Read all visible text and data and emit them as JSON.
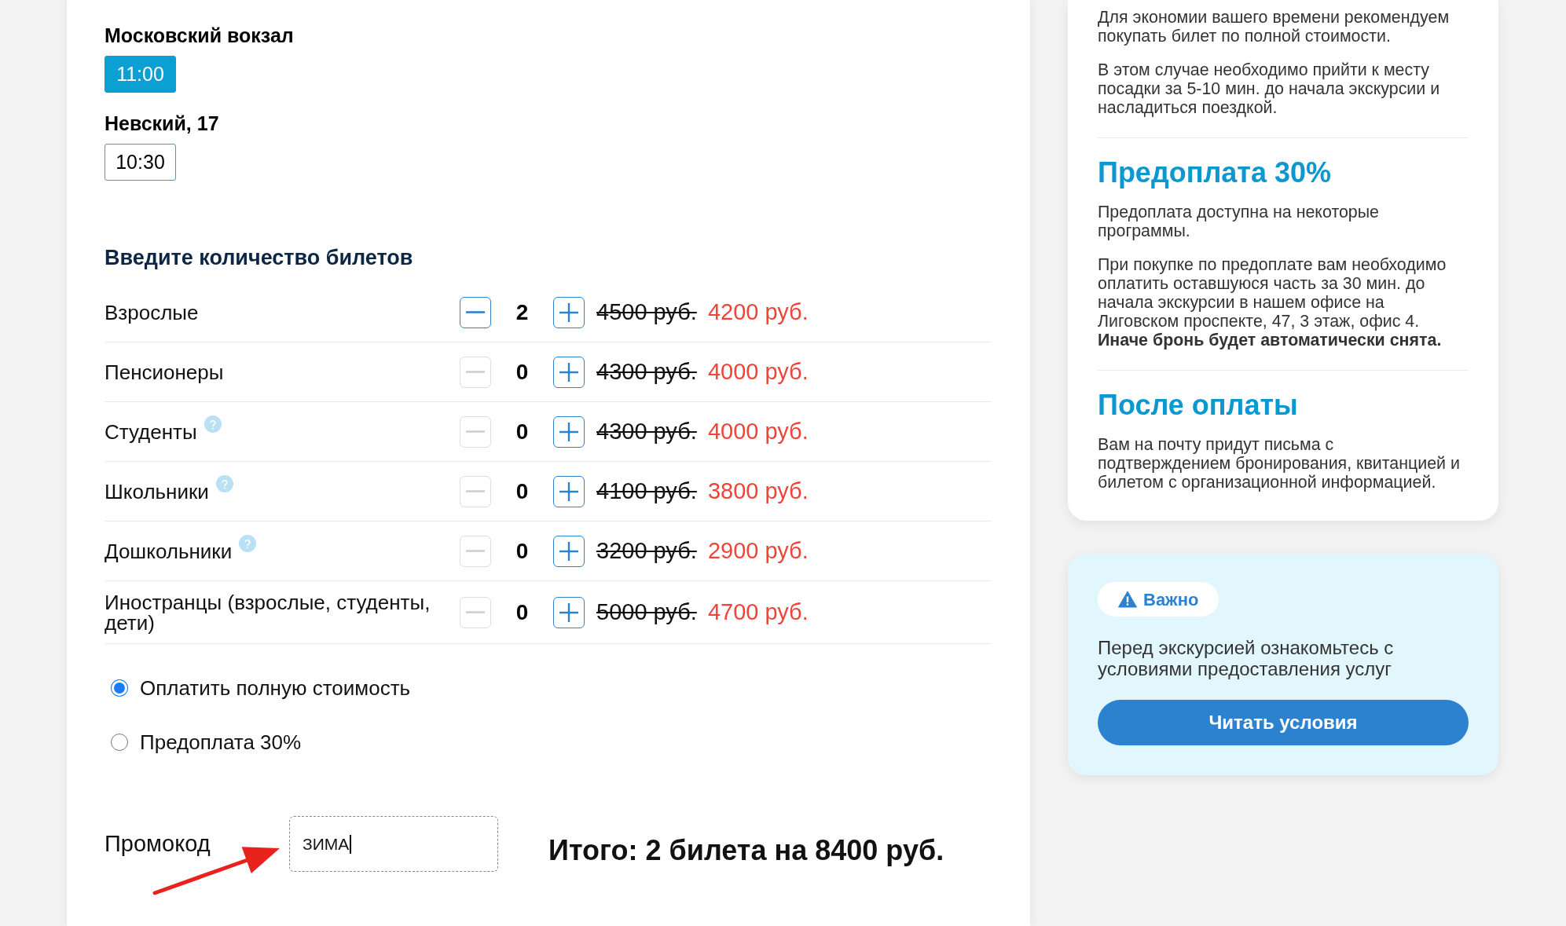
{
  "departures": [
    {
      "place": "Московский вокзал",
      "times": [
        {
          "label": "11:00",
          "selected": true
        }
      ]
    },
    {
      "place": "Невский, 17",
      "times": [
        {
          "label": "10:30",
          "selected": false
        }
      ]
    }
  ],
  "tickets": {
    "title": "Введите количество билетов",
    "rows": [
      {
        "label": "Взрослые",
        "help": false,
        "minus_disabled": false,
        "count": "2",
        "plus_disabled": false,
        "old_price": "4500 руб.",
        "price": "4200 руб."
      },
      {
        "label": "Пенсионеры",
        "help": false,
        "minus_disabled": true,
        "count": "0",
        "plus_disabled": false,
        "old_price": "4300 руб.",
        "price": "4000 руб."
      },
      {
        "label": "Студенты",
        "help": true,
        "minus_disabled": true,
        "count": "0",
        "plus_disabled": false,
        "old_price": "4300 руб.",
        "price": "4000 руб."
      },
      {
        "label": "Школьники",
        "help": true,
        "minus_disabled": true,
        "count": "0",
        "plus_disabled": false,
        "old_price": "4100 руб.",
        "price": "3800 руб."
      },
      {
        "label": "Дошкольники",
        "help": true,
        "minus_disabled": true,
        "count": "0",
        "plus_disabled": false,
        "old_price": "3200 руб.",
        "price": "2900 руб."
      },
      {
        "label": "Иностранцы (взрослые, студенты, дети)",
        "help": false,
        "minus_disabled": true,
        "count": "0",
        "plus_disabled": false,
        "old_price": "5000 руб.",
        "price": "4700 руб."
      }
    ]
  },
  "payment_options": [
    {
      "label": "Оплатить полную стоимость",
      "selected": true
    },
    {
      "label": "Предоплата 30%",
      "selected": false
    }
  ],
  "promo": {
    "label": "Промокод",
    "value": "ЗИМА",
    "focused": true
  },
  "total": "Итого: 2 билета на 8400 руб.",
  "info_card": {
    "sections": [
      {
        "paragraphs": [
          "Для экономии вашего времени рекомендуем покупать билет по полной стоимости.",
          "В этом случае необходимо прийти к месту посадки за 5-10 мин. до начала экскурсии и насладиться поездкой."
        ]
      },
      {
        "title": "Предоплата 30%",
        "paragraphs": [
          "Предоплата доступна на некоторые программы.",
          "При покупке по предоплате вам необходимо оплатить оставшуюся часть за 30 мин. до начала экскурсии в нашем офисе на Лиговском проспекте, 47, 3 этаж, офис 4. **Иначе бронь будет автоматически снята.**"
        ]
      },
      {
        "title": "После оплаты",
        "paragraphs": [
          "Вам на почту придут письма с подтверждением бронирования, квитанцией и билетом с организационной информацией."
        ]
      }
    ]
  },
  "notice": {
    "badge": "Важно",
    "text": "Перед экскурсией ознакомьтесь с условиями предоставления услуг",
    "button": "Читать условия"
  }
}
